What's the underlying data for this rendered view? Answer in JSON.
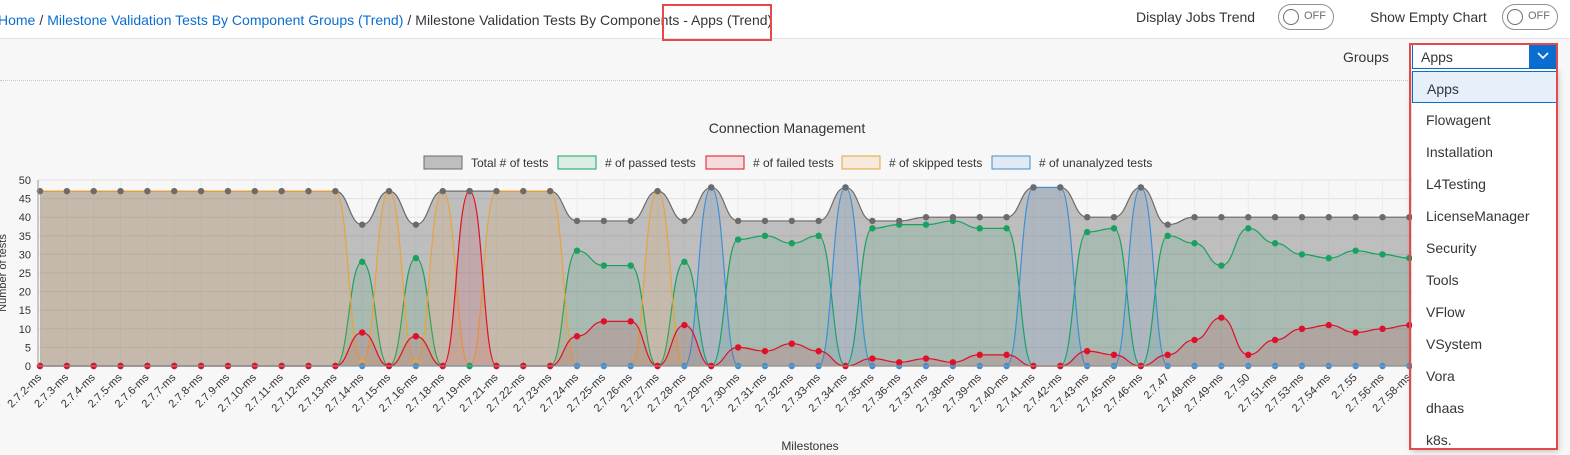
{
  "breadcrumb": {
    "home": "Home",
    "parent": "Milestone Validation Tests By Component Groups (Trend)",
    "current": "Milestone Validation Tests By Components - Apps (Trend)"
  },
  "toggles": {
    "jobs_trend_label": "Display Jobs Trend",
    "jobs_trend_state": "OFF",
    "empty_chart_label": "Show Empty Chart",
    "empty_chart_state": "OFF"
  },
  "groups": {
    "label": "Groups",
    "selected": "Apps",
    "options": [
      "Apps",
      "Flowagent",
      "Installation",
      "L4Testing",
      "LicenseManager",
      "Security",
      "Tools",
      "VFlow",
      "VSystem",
      "Vora",
      "dhaas",
      "k8s."
    ]
  },
  "colors": {
    "accent": "#0a6ed1",
    "highlight": "#e34a4a",
    "total": "#6b6b6b",
    "passed": "#19a25f",
    "failed": "#e0102a",
    "skipped": "#e8a33d",
    "unanalyzed": "#3e8fd6"
  },
  "chart_data": {
    "type": "area",
    "title": "Connection Management",
    "xlabel": "Milestones",
    "ylabel": "Number of tests",
    "ylim": [
      0,
      50
    ],
    "yticks": [
      0,
      5,
      10,
      15,
      20,
      25,
      30,
      35,
      40,
      45,
      50
    ],
    "grid": true,
    "legend_position": "top",
    "categories": [
      "2.7.2-ms",
      "2.7.3-ms",
      "2.7.4-ms",
      "2.7.5-ms",
      "2.7.6-ms",
      "2.7.7-ms",
      "2.7.8-ms",
      "2.7.9-ms",
      "2.7.10-ms",
      "2.7.11-ms",
      "2.7.12-ms",
      "2.7.13-ms",
      "2.7.14-ms",
      "2.7.15-ms",
      "2.7.16-ms",
      "2.7.18-ms",
      "2.7.19-ms",
      "2.7.21-ms",
      "2.7.22-ms",
      "2.7.23-ms",
      "2.7.24-ms",
      "2.7.25-ms",
      "2.7.26-ms",
      "2.7.27-ms",
      "2.7.28-ms",
      "2.7.29-ms",
      "2.7.30-ms",
      "2.7.31-ms",
      "2.7.32-ms",
      "2.7.33-ms",
      "2.7.34-ms",
      "2.7.35-ms",
      "2.7.36-ms",
      "2.7.37-ms",
      "2.7.38-ms",
      "2.7.39-ms",
      "2.7.40-ms",
      "2.7.41-ms",
      "2.7.42-ms",
      "2.7.43-ms",
      "2.7.45-ms",
      "2.7.46-ms",
      "2.7.47",
      "2.7.48-ms",
      "2.7.49-ms",
      "2.7.50",
      "2.7.51-ms",
      "2.7.53-ms",
      "2.7.54-ms",
      "2.7.55",
      "2.7.56-ms",
      "2.7.58-ms"
    ],
    "series": [
      {
        "name": "Total # of tests",
        "color": "#6b6b6b",
        "values": [
          47,
          47,
          47,
          47,
          47,
          47,
          47,
          47,
          47,
          47,
          47,
          47,
          38,
          47,
          38,
          47,
          47,
          47,
          47,
          47,
          39,
          39,
          39,
          47,
          39,
          48,
          39,
          39,
          39,
          39,
          48,
          39,
          39,
          40,
          40,
          40,
          40,
          48,
          48,
          40,
          40,
          48,
          38,
          40,
          40,
          40,
          40,
          40,
          40,
          40,
          40,
          40
        ]
      },
      {
        "name": "# of passed tests",
        "color": "#19a25f",
        "values": [
          0,
          0,
          0,
          0,
          0,
          0,
          0,
          0,
          0,
          0,
          0,
          0,
          28,
          0,
          29,
          0,
          0,
          0,
          0,
          0,
          31,
          27,
          27,
          0,
          28,
          0,
          34,
          35,
          33,
          35,
          0,
          37,
          38,
          38,
          39,
          37,
          37,
          0,
          0,
          36,
          37,
          0,
          35,
          33,
          27,
          37,
          33,
          30,
          29,
          31,
          30,
          29
        ]
      },
      {
        "name": "# of failed tests",
        "color": "#e0102a",
        "values": [
          0,
          0,
          0,
          0,
          0,
          0,
          0,
          0,
          0,
          0,
          0,
          0,
          9,
          0,
          8,
          0,
          47,
          0,
          0,
          0,
          8,
          12,
          12,
          0,
          11,
          0,
          5,
          4,
          6,
          4,
          0,
          2,
          1,
          2,
          1,
          3,
          3,
          0,
          0,
          4,
          3,
          0,
          3,
          7,
          13,
          3,
          7,
          10,
          11,
          9,
          10,
          11
        ]
      },
      {
        "name": "# of skipped tests",
        "color": "#e8a33d",
        "values": [
          47,
          47,
          47,
          47,
          47,
          47,
          47,
          47,
          47,
          47,
          47,
          47,
          1,
          47,
          1,
          47,
          0,
          47,
          47,
          47,
          0,
          0,
          0,
          47,
          0,
          0,
          0,
          0,
          0,
          0,
          0,
          0,
          0,
          0,
          0,
          0,
          0,
          0,
          0,
          0,
          0,
          0,
          0,
          0,
          0,
          0,
          0,
          0,
          0,
          0,
          0,
          0
        ]
      },
      {
        "name": "# of unanalyzed tests",
        "color": "#3e8fd6",
        "values": [
          0,
          0,
          0,
          0,
          0,
          0,
          0,
          0,
          0,
          0,
          0,
          0,
          0,
          0,
          0,
          0,
          0,
          0,
          0,
          0,
          0,
          0,
          0,
          0,
          0,
          48,
          0,
          0,
          0,
          0,
          48,
          0,
          0,
          0,
          0,
          0,
          0,
          48,
          48,
          0,
          0,
          48,
          0,
          0,
          0,
          0,
          0,
          0,
          0,
          0,
          0,
          0
        ]
      }
    ]
  }
}
